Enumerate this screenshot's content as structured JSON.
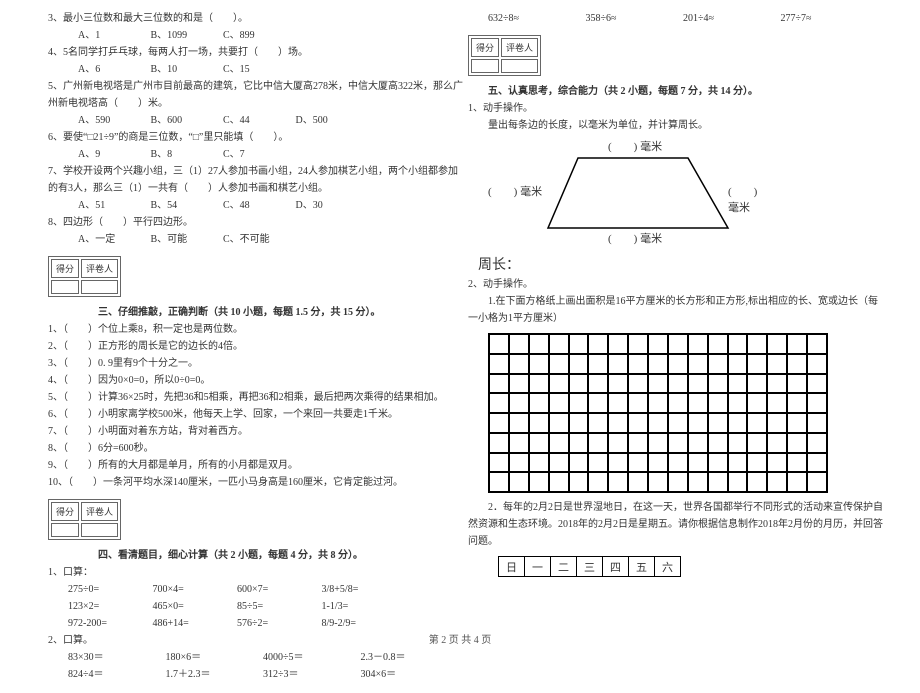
{
  "left": {
    "q3": "3、最小三位数和最大三位数的和是（　　）。",
    "q3_opts": [
      "A、1",
      "B、1099",
      "C、899"
    ],
    "q4": "4、5名同学打乒乓球，每两人打一场，共要打（　　）场。",
    "q4_opts": [
      "A、6",
      "B、10",
      "C、15"
    ],
    "q5a": "5、广州新电视塔是广州市目前最高的建筑，它比中信大厦高278米，中信大厦高322米，那么广",
    "q5b": "州新电视塔高（　　）米。",
    "q5_opts": [
      "A、590",
      "B、600",
      "C、44",
      "D、500"
    ],
    "q6": "6、要使“□21÷9”的商是三位数，“□”里只能填（　　）。",
    "q6_opts": [
      "A、9",
      "B、8",
      "C、7"
    ],
    "q7a": "7、学校开设两个兴趣小组，三（1）27人参加书画小组，24人参加棋艺小组，两个小组都参加",
    "q7b": "的有3人，那么三（1）一共有（　　）人参加书画和棋艺小组。",
    "q7_opts": [
      "A、51",
      "B、54",
      "C、48",
      "D、30"
    ],
    "q8": "8、四边形（　　）平行四边形。",
    "q8_opts": [
      "A、一定",
      "B、可能",
      "C、不可能"
    ],
    "score_header": [
      "得分",
      "评卷人"
    ],
    "sec3_title": "三、仔细推敲，正确判断（共 10 小题，每题 1.5 分，共 15 分）。",
    "j1": "1、（　　）个位上乘8，积一定也是两位数。",
    "j2": "2、（　　）正方形的周长是它的边长的4倍。",
    "j3": "3、（　　）0. 9里有9个十分之一。",
    "j4": "4、（　　）因为0×0=0，所以0÷0=0。",
    "j5": "5、（　　）计算36×25时，先把36和5相乘，再把36和2相乘，最后把两次乘得的结果相加。",
    "j6": "6、（　　）小明家离学校500米，他每天上学、回家，一个来回一共要走1千米。",
    "j7": "7、（　　）小明面对着东方站，背对着西方。",
    "j8": "8、（　　）6分=600秒。",
    "j9": "9、（　　）所有的大月都是单月，所有的小月都是双月。",
    "j10": "10、（　　）一条河平均水深140厘米，一匹小马身高是160厘米，它肯定能过河。",
    "sec4_title": "四、看清题目，细心计算（共 2 小题，每题 4 分，共 8 分）。",
    "c1_label": "1、口算：",
    "c1_r1": [
      "275÷0=",
      "700×4=",
      "600×7=",
      "3/8+5/8="
    ],
    "c1_r2": [
      "123×2=",
      "465×0=",
      "85÷5=",
      "1-1/3="
    ],
    "c1_r3": [
      "972-200=",
      "486+14=",
      "576÷2=",
      "8/9-2/9="
    ],
    "c2_label": "2、口算。",
    "c2_r1": [
      "83×30＝",
      "180×6＝",
      "4000÷5＝",
      "2.3－0.8＝"
    ],
    "c2_r2": [
      "824÷4＝",
      "1.7＋2.3＝",
      "312÷3＝",
      "304×6＝"
    ]
  },
  "right": {
    "top_calc": [
      "632÷8≈",
      "358÷6≈",
      "201÷4≈",
      "277÷7≈"
    ],
    "score_header": [
      "得分",
      "评卷人"
    ],
    "sec5_title": "五、认真思考，综合能力（共 2 小题，每题 7 分，共 14 分）。",
    "p1_label": "1、动手操作。",
    "p1_text": "量出每条边的长度，以毫米为单位，并计算周长。",
    "unit_top": "(　　) 毫米",
    "unit_left": "(　　) 毫米",
    "unit_right": "(　　)毫米",
    "unit_bottom": "(　　) 毫米",
    "zhou_label": "周长：",
    "p2_label": "2、动手操作。",
    "p2_text1": "　　1.在下面方格纸上画出面积是16平方厘米的长方形和正方形,标出相应的长、宽或边长（每",
    "p2_text2": "一小格为1平方厘米）",
    "p2_cal1": "　　2．每年的2月2日是世界湿地日，在这一天，世界各国都举行不同形式的活动来宣传保护自",
    "p2_cal2": "然资源和生态环境。2018年的2月2日是星期五。请你根据信息制作2018年2月份的月历，并回答",
    "p2_cal3": "问题。",
    "weekdays": [
      "日",
      "一",
      "二",
      "三",
      "四",
      "五",
      "六"
    ]
  },
  "footer": "第 2 页 共 4 页",
  "chart_data": {
    "type": "table",
    "title": "Exam page with fill-in questions, arithmetic problems, trapezoid measurement figure, 17×8 blank grid, and blank weekly calendar header",
    "grid": {
      "cols": 17,
      "rows": 8,
      "unit": "1平方厘米"
    },
    "calendar_header": [
      "日",
      "一",
      "二",
      "三",
      "四",
      "五",
      "六"
    ]
  }
}
